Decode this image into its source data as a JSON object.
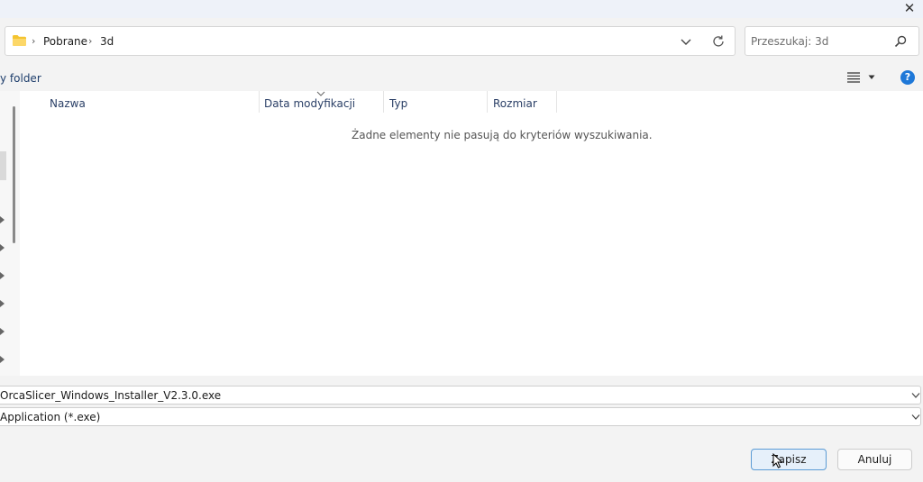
{
  "window": {
    "close_glyph": "✕"
  },
  "address": {
    "breadcrumbs": [
      "Pobrane",
      "3d"
    ],
    "separator": "›"
  },
  "search": {
    "placeholder": "Przeszukaj: 3d"
  },
  "command_bar": {
    "new_folder_label": "y folder",
    "help_glyph": "?"
  },
  "file_list": {
    "columns": [
      "Nazwa",
      "Data modyfikacji",
      "Typ",
      "Rozmiar"
    ],
    "empty_message": "Żadne elementy nie pasują do kryteriów wyszukiwania."
  },
  "form": {
    "file_name": "OrcaSlicer_Windows_Installer_V2.3.0.exe",
    "file_type": "Application (*.exe)"
  },
  "buttons": {
    "save_label": "Zapisz",
    "cancel_label": "Anuluj"
  },
  "icons": [
    "close-icon",
    "folder-icon",
    "chevron-right-icon",
    "chevron-down-icon",
    "refresh-icon",
    "search-icon",
    "view-options-icon",
    "help-icon",
    "expand-arrow-icon",
    "mouse-cursor-icon"
  ],
  "colors": {
    "accent": "#1e78d8",
    "folder": "#f4c430",
    "primary_button_border": "#5b9bd5"
  }
}
